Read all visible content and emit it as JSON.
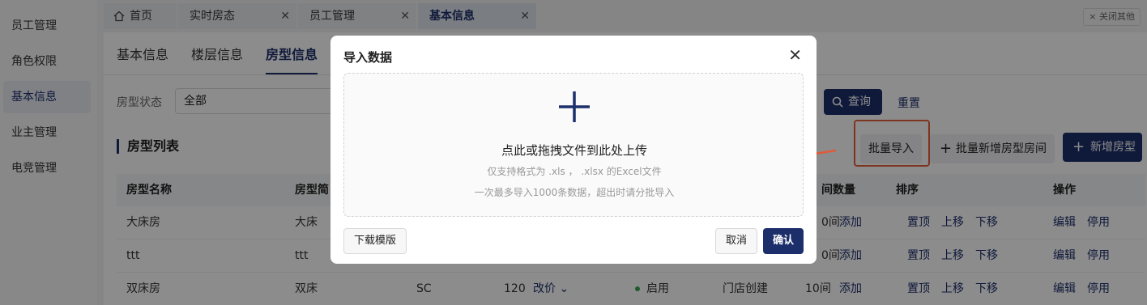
{
  "sidebar": {
    "items": [
      {
        "label": "员工管理"
      },
      {
        "label": "角色权限"
      },
      {
        "label": "基本信息"
      },
      {
        "label": "业主管理"
      },
      {
        "label": "电竞管理"
      }
    ]
  },
  "tabs": {
    "items": [
      {
        "label": "首页"
      },
      {
        "label": "实时房态"
      },
      {
        "label": "员工管理"
      },
      {
        "label": "基本信息"
      }
    ],
    "close_others": "× 关闭其他"
  },
  "subtabs": [
    {
      "label": "基本信息"
    },
    {
      "label": "楼层信息"
    },
    {
      "label": "房型信息"
    }
  ],
  "filter": {
    "label": "房型状态",
    "value": "全部",
    "search": "查询",
    "reset": "重置"
  },
  "list": {
    "title": "房型列表",
    "batch_import": "批量导入",
    "batch_add": "批量新增房型房间",
    "add_type": "新增房型"
  },
  "table": {
    "headers": [
      "房型名称",
      "房型简",
      "间数量",
      "排序",
      "操作"
    ],
    "rows": [
      {
        "name": "大床房",
        "short": "大床",
        "code": "",
        "price": "",
        "price_edit": "",
        "status": "",
        "source": "",
        "rooms": "0间",
        "add": "添加",
        "top": "置顶",
        "up": "上移",
        "down": "下移",
        "edit": "编辑",
        "disable": "停用"
      },
      {
        "name": "ttt",
        "short": "ttt",
        "code": "",
        "price": "",
        "price_edit": "",
        "status": "",
        "source": "",
        "rooms": "0间",
        "add": "添加",
        "top": "置顶",
        "up": "上移",
        "down": "下移",
        "edit": "编辑",
        "disable": "停用"
      },
      {
        "name": "双床房",
        "short": "双床",
        "code": "SC",
        "price": "120",
        "price_edit": "改价",
        "status": "启用",
        "source": "门店创建",
        "rooms": "10间",
        "add": "添加",
        "top": "置顶",
        "up": "上移",
        "down": "下移",
        "edit": "编辑",
        "disable": "停用"
      }
    ]
  },
  "modal": {
    "title": "导入数据",
    "drop_main": "点此或拖拽文件到此处上传",
    "drop_sub1": "仅支持格式为 .xls ， .xlsx 的Excel文件",
    "drop_sub2": "一次最多导入1000条数据，超出时请分批导入",
    "template": "下载模版",
    "cancel": "取消",
    "confirm": "确认"
  },
  "colors": {
    "primary": "#1c2f6b",
    "highlight": "#e8603c",
    "status_on": "#3aa35a"
  }
}
